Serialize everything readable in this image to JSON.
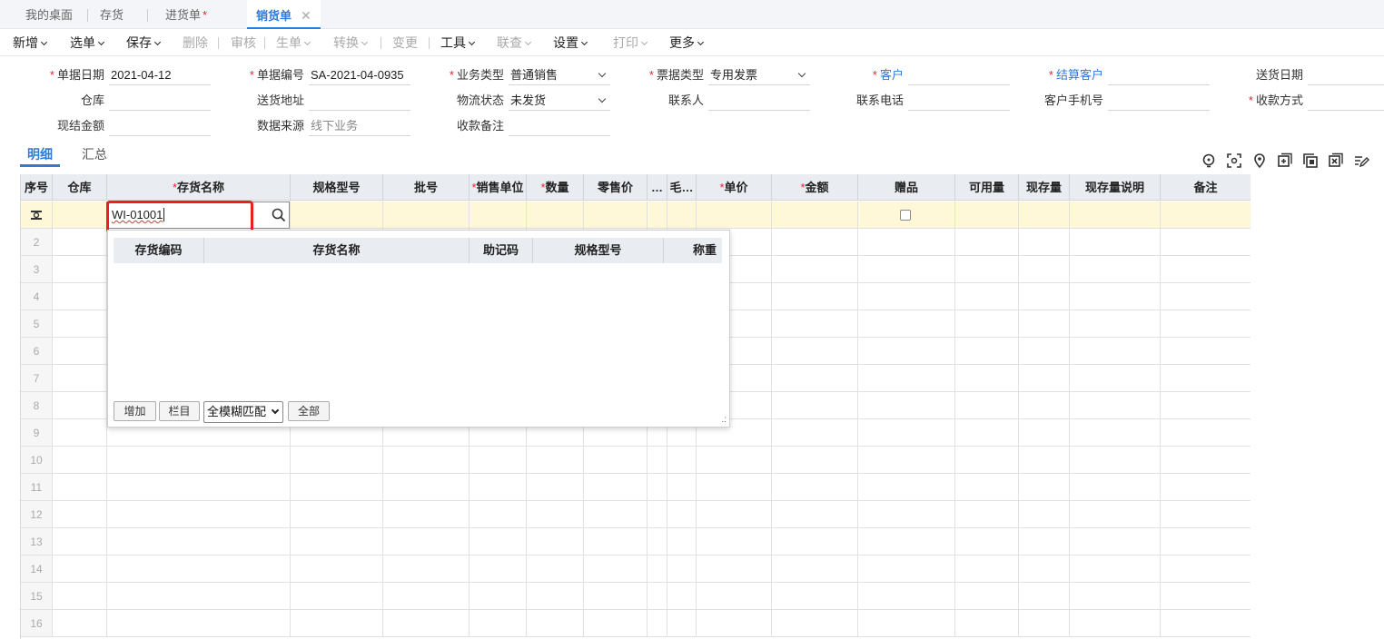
{
  "tabs": [
    {
      "label": "我的桌面",
      "starred": false
    },
    {
      "label": "存货",
      "starred": false
    },
    {
      "label": "进货单",
      "starred": true
    },
    {
      "label": "销货单",
      "starred": false,
      "active": true
    }
  ],
  "tab_star": "*",
  "tab_close": "✕",
  "toolbar": [
    {
      "label": "新增",
      "dropdown": true,
      "disabled": false
    },
    {
      "label": "选单",
      "dropdown": true,
      "disabled": false
    },
    {
      "label": "保存",
      "dropdown": true,
      "disabled": false
    },
    {
      "label": "删除",
      "dropdown": false,
      "disabled": true
    },
    {
      "label": "审核",
      "dropdown": false,
      "disabled": true
    },
    {
      "label": "生单",
      "dropdown": true,
      "disabled": true
    },
    {
      "label": "转换",
      "dropdown": true,
      "disabled": true
    },
    {
      "label": "变更",
      "dropdown": false,
      "disabled": true
    },
    {
      "label": "工具",
      "dropdown": true,
      "disabled": false
    },
    {
      "label": "联查",
      "dropdown": true,
      "disabled": true
    },
    {
      "label": "设置",
      "dropdown": true,
      "disabled": false
    },
    {
      "label": "打印",
      "dropdown": true,
      "disabled": true
    },
    {
      "label": "更多",
      "dropdown": true,
      "disabled": false
    }
  ],
  "form": {
    "doc_date": {
      "label": "单据日期",
      "value": "2021-04-12",
      "required": true
    },
    "doc_no": {
      "label": "单据编号",
      "value": "SA-2021-04-0935",
      "required": true
    },
    "biz_type": {
      "label": "业务类型",
      "value": "普通销售",
      "required": true
    },
    "invoice_type": {
      "label": "票据类型",
      "value": "专用发票",
      "required": true
    },
    "customer": {
      "label": "客户",
      "value": "",
      "required": true
    },
    "settle_customer": {
      "label": "结算客户",
      "value": "",
      "required": true
    },
    "delivery_date": {
      "label": "送货日期",
      "value": ""
    },
    "warehouse": {
      "label": "仓库",
      "value": ""
    },
    "delivery_address": {
      "label": "送货地址",
      "value": ""
    },
    "logistics_status": {
      "label": "物流状态",
      "value": "未发货"
    },
    "contact": {
      "label": "联系人",
      "value": ""
    },
    "contact_phone": {
      "label": "联系电话",
      "value": ""
    },
    "customer_mobile": {
      "label": "客户手机号",
      "value": ""
    },
    "payment_method": {
      "label": "收款方式",
      "value": "",
      "required": true
    },
    "cash_amount": {
      "label": "现结金额",
      "value": ""
    },
    "data_source": {
      "label": "数据来源",
      "value": "线下业务"
    },
    "receipt_note": {
      "label": "收款备注",
      "value": ""
    }
  },
  "req_mark": "*",
  "subtabs": [
    {
      "label": "明细"
    },
    {
      "label": "汇总"
    }
  ],
  "right_icons": [
    "lightbulb-icon",
    "scan-icon",
    "location-icon",
    "add-row-icon",
    "copy-row-icon",
    "delete-row-icon",
    "edit-icon",
    "settings-icon"
  ],
  "grid": {
    "columns": [
      {
        "label": "序号",
        "required": false
      },
      {
        "label": "仓库",
        "required": false
      },
      {
        "label": "存货名称",
        "required": true
      },
      {
        "label": "规格型号",
        "required": false
      },
      {
        "label": "批号",
        "required": false
      },
      {
        "label": "销售单位",
        "required": true
      },
      {
        "label": "数量",
        "required": true
      },
      {
        "label": "零售价",
        "required": false
      },
      {
        "label": "…",
        "required": false
      },
      {
        "label": "毛…",
        "required": false
      },
      {
        "label": "单价",
        "required": true
      },
      {
        "label": "金额",
        "required": true
      },
      {
        "label": "赠品",
        "required": false
      },
      {
        "label": "可用量",
        "required": false
      },
      {
        "label": "现存量",
        "required": false
      },
      {
        "label": "现存量说明",
        "required": false
      },
      {
        "label": "备注",
        "required": false
      }
    ],
    "row_numbers": [
      "2",
      "3",
      "4",
      "5",
      "6",
      "7",
      "8",
      "9",
      "10",
      "11",
      "12",
      "13",
      "14",
      "15",
      "16"
    ],
    "edit_value": "WI-01001"
  },
  "popup": {
    "columns": [
      {
        "label": "存货编码"
      },
      {
        "label": "存货名称"
      },
      {
        "label": "助记码"
      },
      {
        "label": "规格型号"
      },
      {
        "label": "称重"
      }
    ],
    "add_button": "增加",
    "columns_button": "栏目",
    "match_mode": "全模糊匹配",
    "all_button": "全部"
  }
}
